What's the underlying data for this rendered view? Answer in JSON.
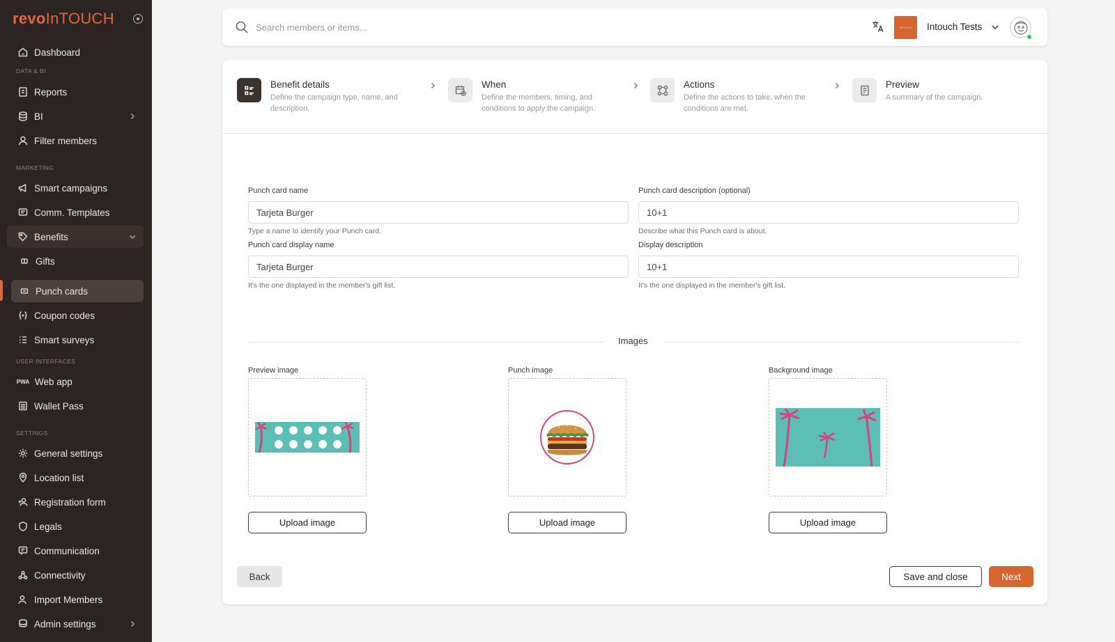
{
  "brand": {
    "part1": "revo",
    "part2": "InTOUCH"
  },
  "sidebar": {
    "sections": {
      "data": "DATA & BI",
      "marketing": "MARKETING",
      "ui": "USER INTERFACES",
      "settings": "SETTINGS"
    },
    "items": {
      "dashboard": "Dashboard",
      "reports": "Reports",
      "bi": "BI",
      "filter_members": "Filter members",
      "smart_campaigns": "Smart campaigns",
      "comm_templates": "Comm. Templates",
      "benefits": "Benefits",
      "gifts": "Gifts",
      "punch_cards": "Punch cards",
      "coupon_codes": "Coupon codes",
      "smart_surveys": "Smart surveys",
      "web_app": "Web app",
      "wallet_pass": "Wallet Pass",
      "general_settings": "General settings",
      "location_list": "Location list",
      "registration_form": "Registration form",
      "legals": "Legals",
      "communication": "Communication",
      "connectivity": "Connectivity",
      "import_members": "Import Members",
      "admin_settings": "Admin settings"
    }
  },
  "topbar": {
    "search_placeholder": "Search members or items...",
    "org_logo_text": "INTOUCH",
    "org_name": "Intouch Tests"
  },
  "stepper": [
    {
      "title": "Benefit details",
      "desc": "Define the campaign type, name, and description."
    },
    {
      "title": "When",
      "desc": "Define the members, timing, and conditions to apply the campaign."
    },
    {
      "title": "Actions",
      "desc": "Define the actions to take, when the conditions are met."
    },
    {
      "title": "Preview",
      "desc": "A summary of the campaign."
    }
  ],
  "form": {
    "name_label": "Punch card name",
    "name_value": "Tarjeta Burger",
    "name_help": "Type a name to identify your Punch card.",
    "desc_label": "Punch card description (optional)",
    "desc_value": "10+1",
    "desc_help": "Describe what this Punch card is about.",
    "display_name_label": "Punch card display name",
    "display_name_value": "Tarjeta Burger",
    "display_name_help": "It's the one displayed in the member's gift list.",
    "display_desc_label": "Display description",
    "display_desc_value": "10+1",
    "display_desc_help": "It's the one displayed in the member's gift list."
  },
  "images": {
    "section_title": "Images",
    "preview_label": "Preview image",
    "punch_label": "Punch image",
    "background_label": "Background image",
    "upload_label": "Upload image"
  },
  "footer": {
    "back": "Back",
    "save_close": "Save and close",
    "next": "Next"
  },
  "colors": {
    "accent": "#d7652e",
    "sidebar_bg": "#2c2422",
    "teal": "#5cbfb6",
    "palm_pink": "#d8417a"
  }
}
